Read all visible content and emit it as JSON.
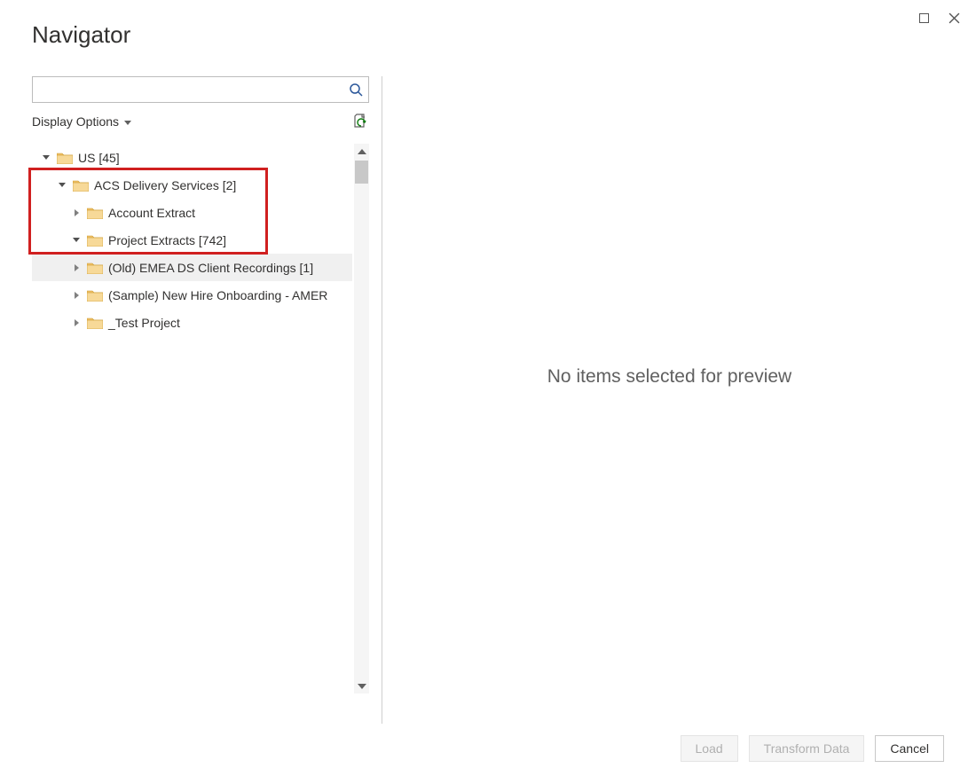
{
  "window": {
    "title": "Navigator"
  },
  "search": {
    "value": "",
    "placeholder": ""
  },
  "options": {
    "display_options_label": "Display Options"
  },
  "tree": {
    "nodes": [
      {
        "label": "US [45]",
        "indent": 0,
        "expanded": true,
        "selected": false
      },
      {
        "label": "ACS Delivery Services [2]",
        "indent": 1,
        "expanded": true,
        "selected": false
      },
      {
        "label": "Account Extract",
        "indent": 2,
        "expanded": false,
        "selected": false
      },
      {
        "label": "Project Extracts [742]",
        "indent": 2,
        "expanded": true,
        "selected": false
      },
      {
        "label": "(Old) EMEA DS Client Recordings [1]",
        "indent": 3,
        "expanded": false,
        "selected": true
      },
      {
        "label": "(Sample) New Hire Onboarding - AMER",
        "indent": 3,
        "expanded": false,
        "selected": false
      },
      {
        "label": "_Test Project",
        "indent": 3,
        "expanded": false,
        "selected": false
      }
    ]
  },
  "preview": {
    "empty_message": "No items selected for preview"
  },
  "footer": {
    "load": "Load",
    "transform": "Transform Data",
    "cancel": "Cancel"
  }
}
